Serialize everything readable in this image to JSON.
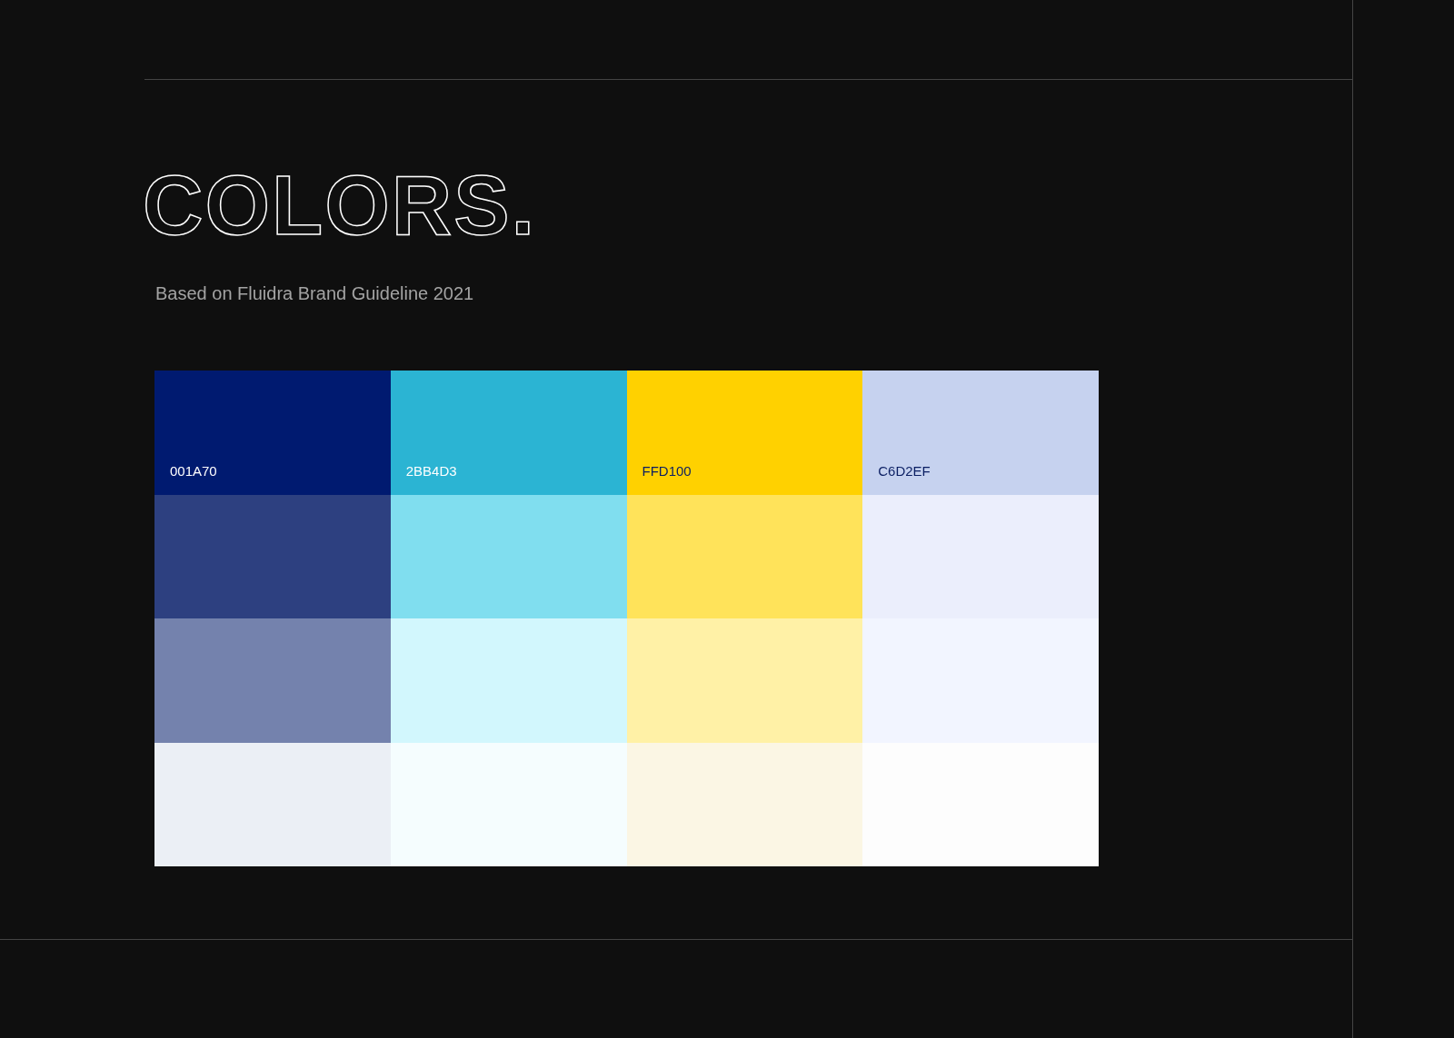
{
  "title": "COLORS.",
  "subtitle": "Based on Fluidra Brand Guideline 2021",
  "palette": [
    {
      "code": "001A70",
      "swatches": [
        {
          "color": "#001a70"
        },
        {
          "color": "#2d4080"
        },
        {
          "color": "#7482ad"
        },
        {
          "color": "#ebeff5"
        }
      ]
    },
    {
      "code": "2BB4D3",
      "swatches": [
        {
          "color": "#2bb4d3"
        },
        {
          "color": "#80deef"
        },
        {
          "color": "#d2f7fd"
        },
        {
          "color": "#f5fdfe"
        }
      ]
    },
    {
      "code": "FFD100",
      "swatches": [
        {
          "color": "#ffd100"
        },
        {
          "color": "#ffe35a"
        },
        {
          "color": "#fff1a6"
        },
        {
          "color": "#fbf6e4"
        }
      ]
    },
    {
      "code": "C6D2EF",
      "swatches": [
        {
          "color": "#c6d2ef"
        },
        {
          "color": "#ebeefc"
        },
        {
          "color": "#f2f5ff"
        },
        {
          "color": "#fdfdfd"
        }
      ]
    }
  ]
}
